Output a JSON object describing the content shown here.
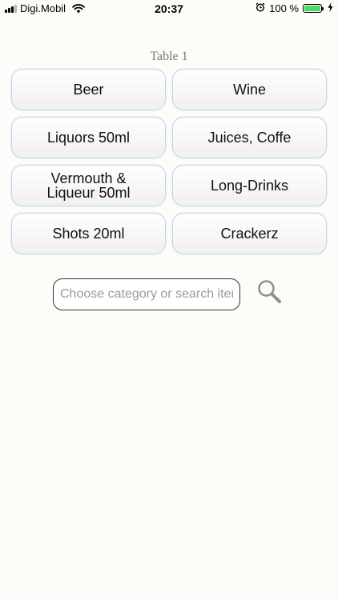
{
  "status_bar": {
    "carrier": "Digi.Mobil",
    "time": "20:37",
    "battery": "100 %",
    "battery_level": 1.0,
    "icons": [
      "signal-icon",
      "wifi-icon",
      "alarm-icon",
      "battery-icon",
      "charging-icon"
    ]
  },
  "table": {
    "title": "Table 1"
  },
  "categories": [
    {
      "label": "Beer"
    },
    {
      "label": "Wine"
    },
    {
      "label": "Liquors 50ml"
    },
    {
      "label": "Juices, Coffe"
    },
    {
      "label": "Vermouth &\nLiqueur 50ml"
    },
    {
      "label": "Long-Drinks"
    },
    {
      "label": "Shots 20ml"
    },
    {
      "label": "Crackerz"
    }
  ],
  "search": {
    "placeholder": "Choose category or search item",
    "value": ""
  },
  "colors": {
    "background": "#fdfcf9",
    "button_border": "#b9d8ee",
    "battery_fill": "#4cd964",
    "search_icon": "#8e8e8e"
  }
}
